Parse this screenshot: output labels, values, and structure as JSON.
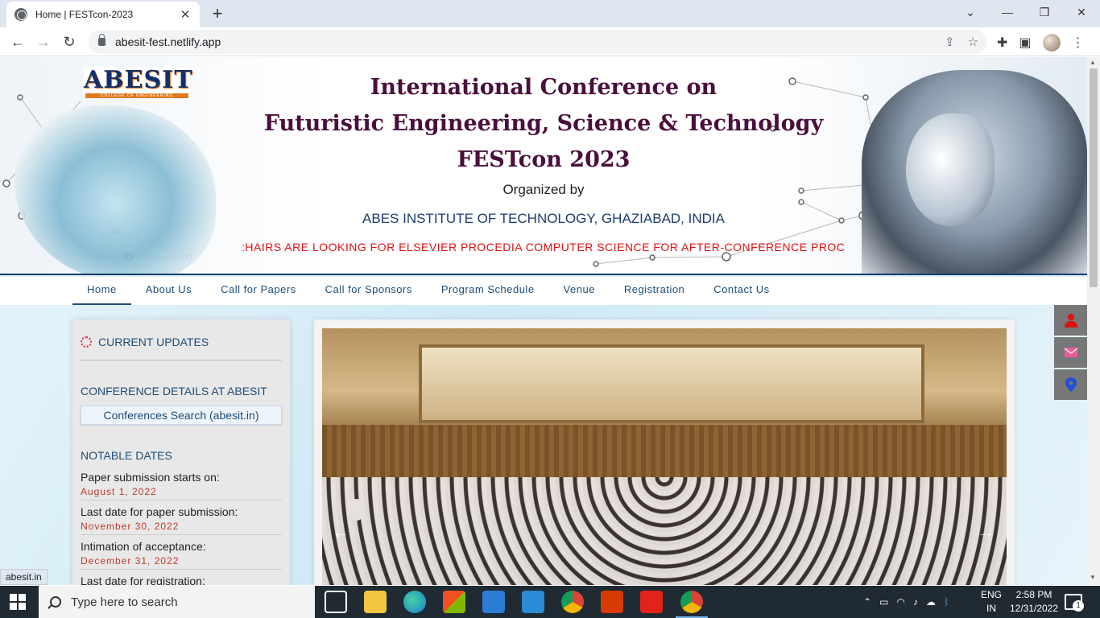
{
  "browser": {
    "tab_title": "Home | FESTcon-2023",
    "url": "abesit-fest.netlify.app",
    "status_url": "abesit.in"
  },
  "banner": {
    "logo_text": "ABESIT",
    "logo_sub": "COLLEGE OF ENGINEERING",
    "title_line1": "International Conference on",
    "title_line2": "Futuristic Engineering, Science & Technology",
    "title_line3": "FESTcon  2023",
    "organized_by": "Organized by",
    "institute": "ABES INSTITUTE OF TECHNOLOGY, GHAZIABAD, INDIA",
    "marquee": ":HAIRS ARE LOOKING FOR ELSEVIER PROCEDIA COMPUTER SCIENCE FOR AFTER-CONFERENCE PROCEEI"
  },
  "nav": {
    "items": [
      {
        "label": "Home"
      },
      {
        "label": "About Us"
      },
      {
        "label": "Call for Papers"
      },
      {
        "label": "Call for Sponsors"
      },
      {
        "label": "Program Schedule"
      },
      {
        "label": "Venue"
      },
      {
        "label": "Registration"
      },
      {
        "label": "Contact Us"
      }
    ],
    "active": "Home"
  },
  "sidebar": {
    "heading": "CURRENT UPDATES",
    "conference_heading": "CONFERENCE DETAILS AT ABESIT",
    "conference_link": "Conferences Search (abesit.in)",
    "dates_heading": "NOTABLE DATES",
    "dates": [
      {
        "label": "Paper submission starts on:",
        "value": "August 1, 2022"
      },
      {
        "label": "Last date for paper submission:",
        "value": "November 30, 2022"
      },
      {
        "label": "Intimation of acceptance:",
        "value": "December 31, 2022"
      },
      {
        "label": "Last date for registration:",
        "value": ""
      }
    ]
  },
  "slider": {
    "prev_arrow": "←",
    "next_arrow": "→"
  },
  "floating_icons": [
    "person-icon",
    "mail-icon",
    "location-pin-icon"
  ],
  "taskbar": {
    "search_placeholder": "Type here to search",
    "lang_line1": "ENG",
    "lang_line2": "IN",
    "time": "2:58 PM",
    "date": "12/31/2022",
    "notification_count": "1"
  },
  "colors": {
    "title": "#4a0f3c",
    "nav_text": "#1d4d78",
    "marquee": "#e01010",
    "date_value": "#c0392b"
  }
}
